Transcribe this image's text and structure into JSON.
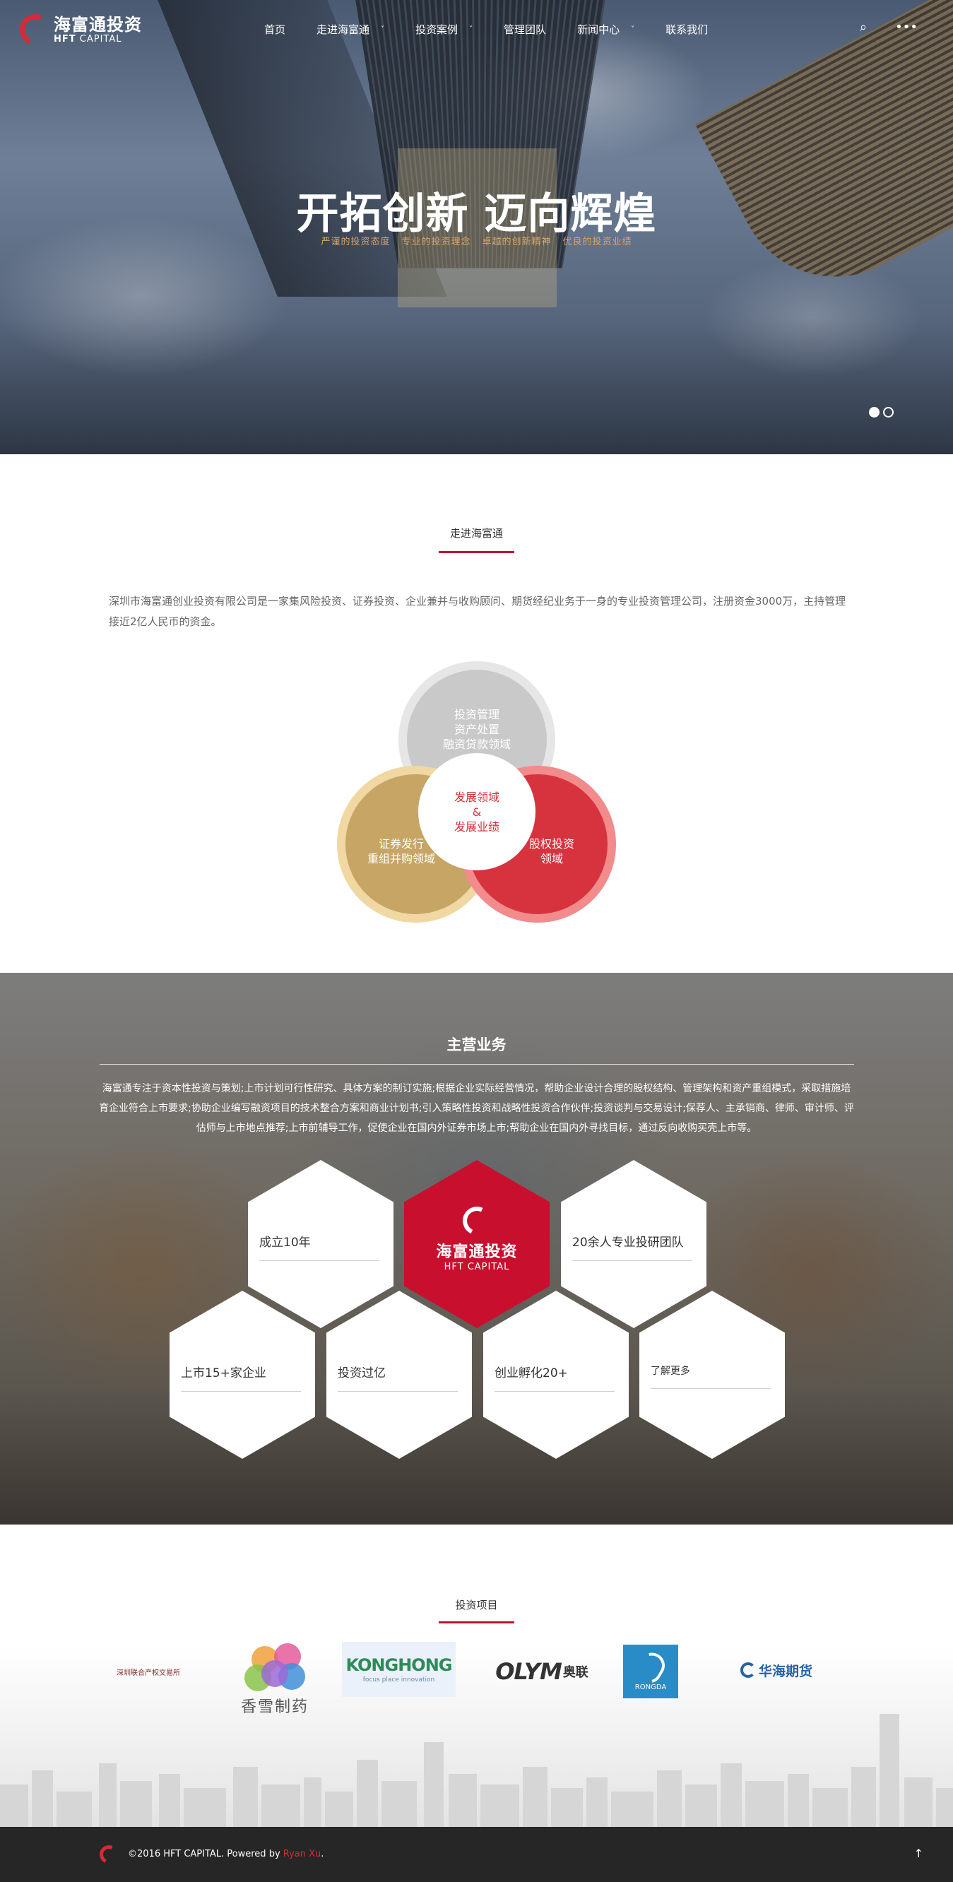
{
  "header": {
    "logo_cn": "海富通投资",
    "logo_en_bold": "HFT",
    "logo_en_rest": "CAPITAL",
    "nav": [
      {
        "label": "首页",
        "has_dropdown": false
      },
      {
        "label": "走进海富通",
        "has_dropdown": true
      },
      {
        "label": "投资案例",
        "has_dropdown": true
      },
      {
        "label": "管理团队",
        "has_dropdown": false
      },
      {
        "label": "新闻中心",
        "has_dropdown": true
      },
      {
        "label": "联系我们",
        "has_dropdown": false
      }
    ],
    "tools": {
      "search_icon": "⌕",
      "more_icon": "•••"
    }
  },
  "hero": {
    "title": "开拓创新 迈向辉煌",
    "subtitle": [
      "严谨的投资态度",
      "专业的投资理念",
      "卓越的创新精神",
      "优良的投资业绩"
    ],
    "slides": 2,
    "active_slide": 1
  },
  "about": {
    "title": "走进海富通",
    "text": "深圳市海富通创业投资有限公司是一家集风险投资、证券投资、企业兼并与收购顾问、期货经纪业务于一身的专业投资管理公司，注册资金3000万，主持管理接近2亿人民币的资金。",
    "circles": {
      "top": [
        "投资管理",
        "资产处置",
        "融资贷款领域"
      ],
      "left": [
        "证券发行",
        "重组并购领域"
      ],
      "right": [
        "股权投资",
        "领域"
      ],
      "center": [
        "发展领域",
        "&",
        "发展业绩"
      ]
    }
  },
  "business": {
    "title": "主营业务",
    "text": "海富通专注于资本性投资与策划;上市计划可行性研究、具体方案的制订实施;根据企业实际经营情况，帮助企业设计合理的股权结构、管理架构和资产重组模式，采取措施培育企业符合上市要求;协助企业编写融资项目的技术整合方案和商业计划书;引入策略性投资和战略性投资合作伙伴;投资谈判与交易设计;保荐人、主承销商、律师、审计师、评估师与上市地点推荐;上市前辅导工作，促使企业在国内外证券市场上市;帮助企业在国内外寻找目标，通过反向收购买壳上市等。",
    "hexes": {
      "h1": "成立10年",
      "h2_logo_cn": "海富通投资",
      "h2_logo_en": "HFT CAPITAL",
      "h3": "20余人专业投研团队",
      "h4": "上市15+家企业",
      "h5": "投资过亿",
      "h6": "创业孵化20+",
      "h7": "了解更多"
    }
  },
  "projects": {
    "title": "投资项目",
    "logos": {
      "l1": "深圳联合产权交易所",
      "l2": "香雪制药",
      "l3_big": "KONGHONG",
      "l3_small": "focus place innovation",
      "l4_en": "OLYM",
      "l4_cn": "奥联",
      "l5": "RONGDA",
      "l6": "华海期货"
    }
  },
  "footer": {
    "copyright": "©2016 HFT CAPITAL. Powered by ",
    "author": "Ryan Xu",
    "end": ".",
    "back_top_icon": "↑"
  },
  "colors": {
    "accent_red": "#c8102e",
    "gold": "#c6a565",
    "grey": "#c9c9c9"
  }
}
